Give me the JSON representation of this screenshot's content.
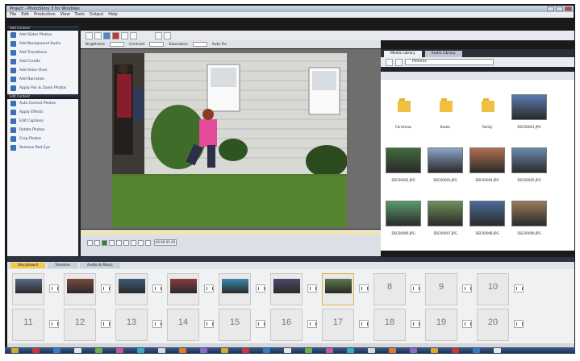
{
  "window": {
    "title": "Project - PhotoStory 3 for Windows"
  },
  "menu": [
    "File",
    "Edit",
    "Production",
    "View",
    "Tools",
    "Output",
    "Help"
  ],
  "tasks_header": "Add Content",
  "tasks_header2": "Edit Content",
  "tasks": [
    "Add Slides Photos",
    "Add Background Audio",
    "Add Transitions",
    "Add Credits",
    "Add Voice-Over",
    "Add Narration",
    "Apply Pan & Zoom Photos"
  ],
  "edit_tasks": [
    "Auto Correct Photos",
    "Apply Effects",
    "Edit Captions",
    "Rotate Photos",
    "Crop Photos",
    "Remove Red Eye"
  ],
  "adjust": {
    "brightness": "Brightness",
    "contrast": "Contrast",
    "saturation": "Saturation",
    "auto": "Auto Fix"
  },
  "library": {
    "tabs": [
      "Media Library",
      "Audio Library"
    ],
    "address": "Pictures",
    "items": [
      {
        "kind": "folder",
        "label": "Christmas"
      },
      {
        "kind": "folder",
        "label": "Easter"
      },
      {
        "kind": "folder",
        "label": "Family"
      },
      {
        "kind": "photo",
        "label": "DSC00001.JPG"
      },
      {
        "kind": "photo",
        "label": "DSC00002.JPG"
      },
      {
        "kind": "photo",
        "label": "DSC00003.JPG"
      },
      {
        "kind": "photo",
        "label": "DSC00004.JPG"
      },
      {
        "kind": "photo",
        "label": "DSC00005.JPG"
      },
      {
        "kind": "photo",
        "label": "DSC00006.JPG"
      },
      {
        "kind": "photo",
        "label": "DSC00007.JPG"
      },
      {
        "kind": "photo",
        "label": "DSC00008.JPG"
      },
      {
        "kind": "photo",
        "label": "DSC00009.JPG"
      }
    ]
  },
  "transport": {
    "split_label": "00:00:05.00"
  },
  "storyboard": {
    "tabs": [
      "Storyboard",
      "Timeline",
      "Audio & Music"
    ],
    "row1": [
      "",
      "",
      "",
      "",
      "",
      "",
      "",
      "8",
      "9",
      "10"
    ],
    "row2": [
      "11",
      "12",
      "13",
      "14",
      "15",
      "16",
      "17",
      "18",
      "19",
      "20"
    ]
  }
}
